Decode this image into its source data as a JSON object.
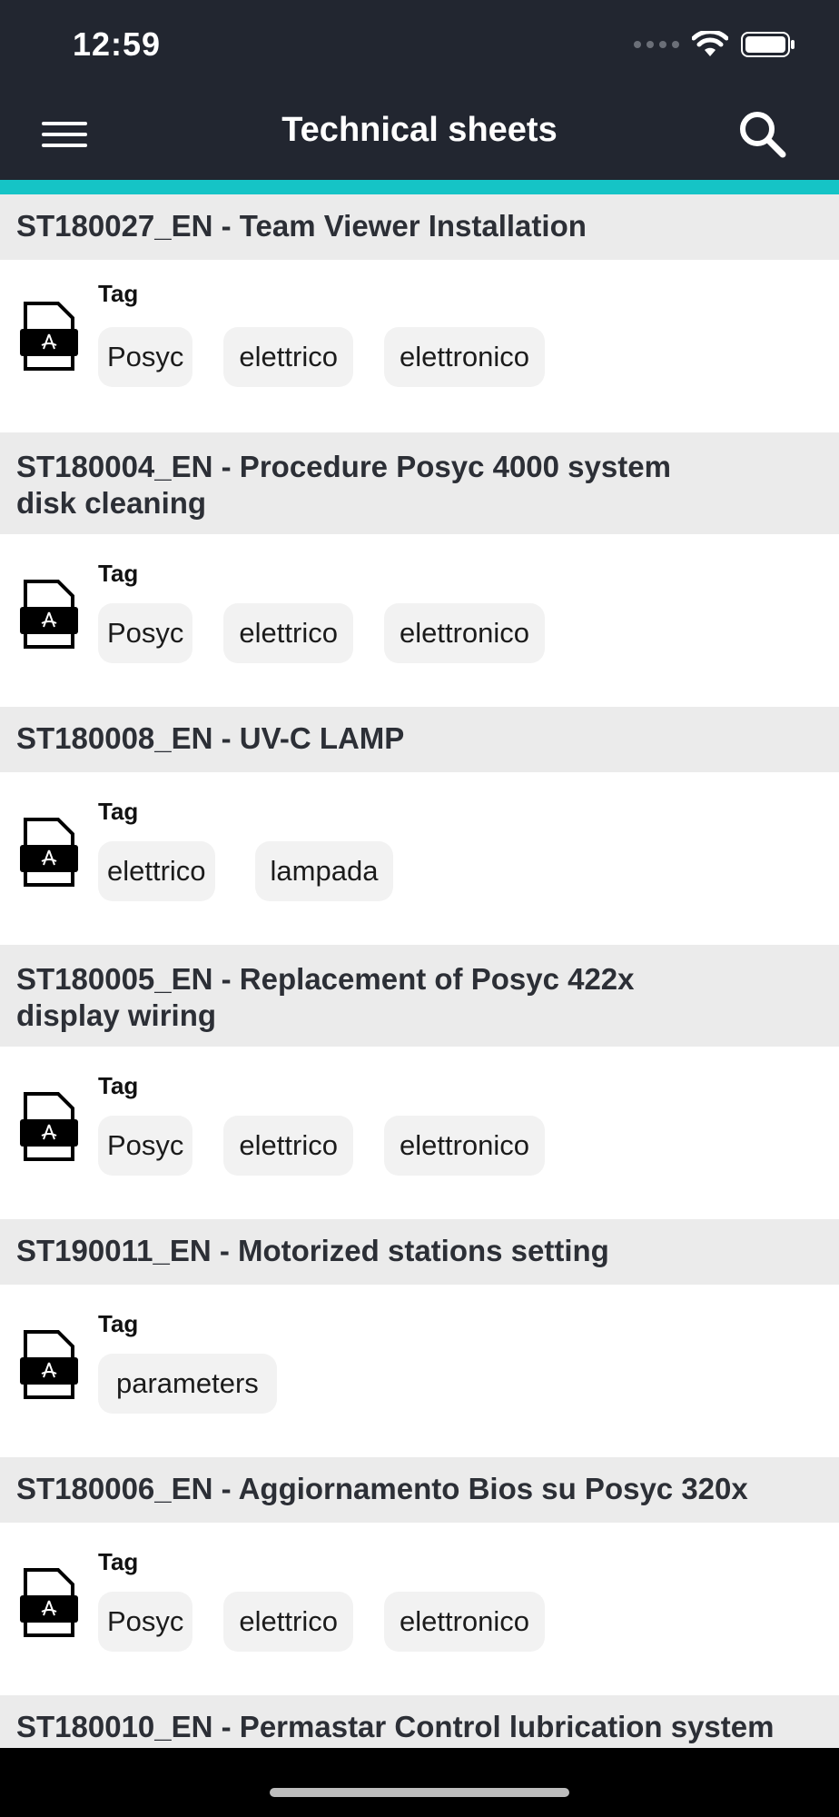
{
  "status_bar": {
    "time": "12:59"
  },
  "nav": {
    "title": "Technical sheets",
    "menu_icon": "hamburger-menu-icon",
    "search_icon": "search-icon"
  },
  "colors": {
    "bar": "#222630",
    "accent": "#15c4c6",
    "section_bg": "#ebebeb",
    "chip_bg": "#f2f2f2"
  },
  "tag_label": "Tag",
  "sheets": [
    {
      "title": "ST180027_EN - Team Viewer Installation",
      "tags": [
        "Posyc",
        "elettrico",
        "elettronico"
      ]
    },
    {
      "title": "ST180004_EN - Procedure Posyc 4000 system disk cleaning",
      "tags": [
        "Posyc",
        "elettrico",
        "elettronico"
      ]
    },
    {
      "title": "ST180008_EN - UV-C LAMP",
      "tags": [
        "elettrico",
        "lampada"
      ]
    },
    {
      "title": "ST180005_EN - Replacement of Posyc 422x display wiring",
      "tags": [
        "Posyc",
        "elettrico",
        "elettronico"
      ]
    },
    {
      "title": "ST190011_EN - Motorized stations setting",
      "tags": [
        "parameters"
      ]
    },
    {
      "title": "ST180006_EN - Aggiornamento Bios su Posyc 320x",
      "tags": [
        "Posyc",
        "elettrico",
        "elettronico"
      ]
    },
    {
      "title": "ST180010_EN - Permastar Control lubrication system",
      "tags": []
    }
  ]
}
